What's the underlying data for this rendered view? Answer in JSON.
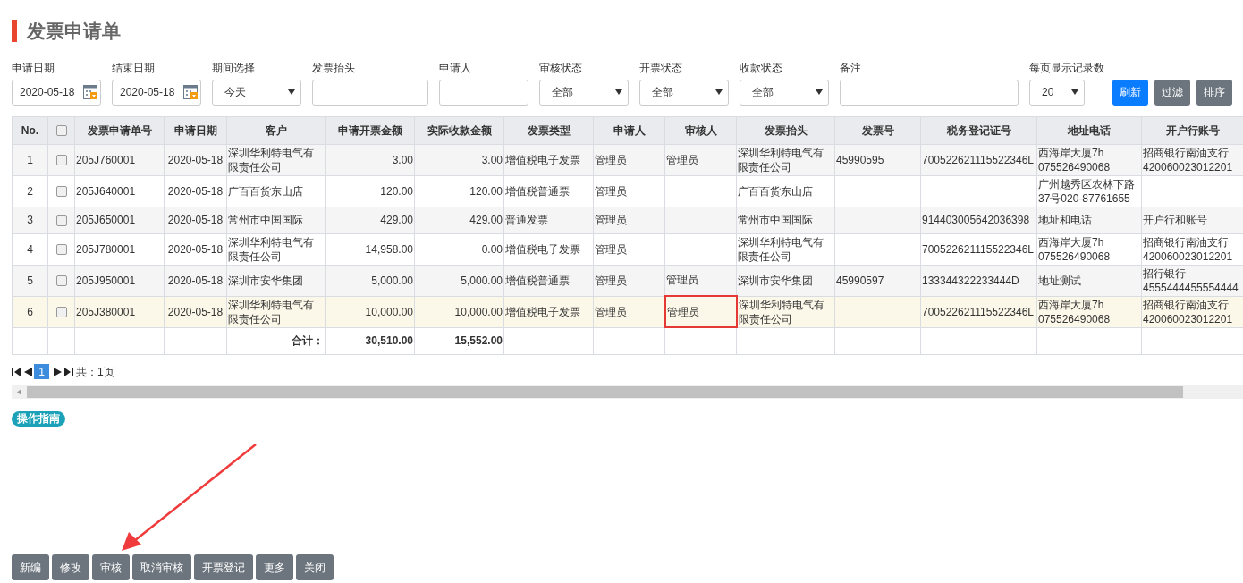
{
  "title": "发票申请单",
  "filters": [
    {
      "kind": "date",
      "label": "申请日期",
      "value": "2020-05-18"
    },
    {
      "kind": "date",
      "label": "结束日期",
      "value": "2020-05-18"
    },
    {
      "kind": "select",
      "label": "期间选择",
      "value": "今天"
    },
    {
      "kind": "text",
      "label": "发票抬头"
    },
    {
      "kind": "text",
      "label": "申请人"
    },
    {
      "kind": "select",
      "label": "审核状态",
      "value": "全部"
    },
    {
      "kind": "select",
      "label": "开票状态",
      "value": "全部"
    },
    {
      "kind": "select",
      "label": "收款状态",
      "value": "全部"
    },
    {
      "kind": "wide",
      "label": "备注"
    },
    {
      "kind": "small",
      "label": "每页显示记录数",
      "value": "20"
    }
  ],
  "filter_buttons": [
    {
      "label": "刷新",
      "primary": true
    },
    {
      "label": "过滤",
      "primary": false
    },
    {
      "label": "排序",
      "primary": false
    }
  ],
  "table": {
    "columns": [
      {
        "label": "No."
      },
      {
        "kind": "checkbox",
        "checked": false
      },
      {
        "label": "发票申请单号"
      },
      {
        "label": "申请日期"
      },
      {
        "label": "客户"
      },
      {
        "label": "申请开票金额"
      },
      {
        "label": "实际收款金额"
      },
      {
        "label": "发票类型"
      },
      {
        "label": "申请人"
      },
      {
        "label": "审核人"
      },
      {
        "label": "发票抬头"
      },
      {
        "label": "发票号"
      },
      {
        "label": "税务登记证号"
      },
      {
        "label": "地址电话"
      },
      {
        "label": "开户行账号"
      }
    ],
    "rows": [
      {
        "highlighted": false,
        "reviewer_marked": false,
        "cells": [
          "1",
          {
            "checked": false
          },
          "205J760001",
          "2020-05-18",
          "深圳华利特电气有限责任公司",
          "3.00",
          "3.00",
          "增值税电子发票",
          "管理员",
          "管理员",
          "深圳华利特电气有限责任公司",
          "45990595",
          "700522621115522346L",
          "西海岸大厦7h 075526490068",
          "招商银行南油支行420060023012201"
        ]
      },
      {
        "highlighted": false,
        "reviewer_marked": false,
        "cells": [
          "2",
          {
            "checked": false
          },
          "205J640001",
          "2020-05-18",
          "广百百货东山店",
          "120.00",
          "120.00",
          "增值税普通票",
          "管理员",
          "",
          "广百百货东山店",
          "",
          "",
          "广州越秀区农林下路37号020-87761655",
          ""
        ]
      },
      {
        "highlighted": false,
        "reviewer_marked": false,
        "cells": [
          "3",
          {
            "checked": false
          },
          "205J650001",
          "2020-05-18",
          "常州市中国国际",
          "429.00",
          "429.00",
          "普通发票",
          "管理员",
          "",
          "常州市中国国际",
          "",
          "914403005642036398",
          "地址和电话",
          "开户行和账号"
        ]
      },
      {
        "highlighted": false,
        "reviewer_marked": false,
        "cells": [
          "4",
          {
            "checked": false
          },
          "205J780001",
          "2020-05-18",
          "深圳华利特电气有限责任公司",
          "14,958.00",
          "0.00",
          "增值税电子发票",
          "管理员",
          "",
          "深圳华利特电气有限责任公司",
          "",
          "700522621115522346L",
          "西海岸大厦7h 075526490068",
          "招商银行南油支行420060023012201"
        ]
      },
      {
        "highlighted": false,
        "reviewer_marked": false,
        "cells": [
          "5",
          {
            "checked": false
          },
          "205J950001",
          "2020-05-18",
          "深圳市安华集团",
          "5,000.00",
          "5,000.00",
          "增值税普通票",
          "管理员",
          "管理员",
          "深圳市安华集团",
          "45990597",
          "133344322233444D",
          "地址测试",
          "招行银行4555444455554444"
        ]
      },
      {
        "highlighted": true,
        "reviewer_marked": true,
        "cells": [
          "6",
          {
            "checked": false
          },
          "205J380001",
          "2020-05-18",
          "深圳华利特电气有限责任公司",
          "10,000.00",
          "10,000.00",
          "增值税电子发票",
          "管理员",
          "管理员",
          "深圳华利特电气有限责任公司",
          "",
          "700522621115522346L",
          "西海岸大厦7h 075526490068",
          "招商银行南油支行420060023012201"
        ]
      }
    ],
    "totals": {
      "label": "合计：",
      "invoice_amount": "30,510.00",
      "received_amount": "15,552.00"
    }
  },
  "pagination": {
    "pages": [
      {
        "label": "1",
        "selected": true
      }
    ],
    "summary": "共：1页"
  },
  "guide_badge": "操作指南",
  "actions": [
    "新编",
    "修改",
    "审核",
    "取消审核",
    "开票登记",
    "更多",
    "关闭"
  ]
}
